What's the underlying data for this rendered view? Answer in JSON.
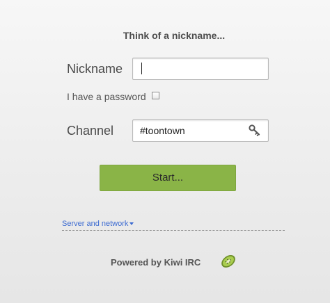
{
  "header": {
    "title": "Think of a nickname..."
  },
  "form": {
    "nickname_label": "Nickname",
    "nickname_value": "",
    "password_label": "I have a password",
    "password_checked": false,
    "channel_label": "Channel",
    "channel_value": "#toontown",
    "start_label": "Start..."
  },
  "links": {
    "server_network": "Server and network"
  },
  "footer": {
    "powered_by": "Powered by Kiwi IRC"
  },
  "icons": {
    "channel_key": "key-icon",
    "server_toggle": "dropdown-arrow-icon",
    "brand": "kiwi-logo-icon"
  },
  "colors": {
    "accent_green": "#8ab447",
    "link_blue": "#3b6ad1"
  }
}
